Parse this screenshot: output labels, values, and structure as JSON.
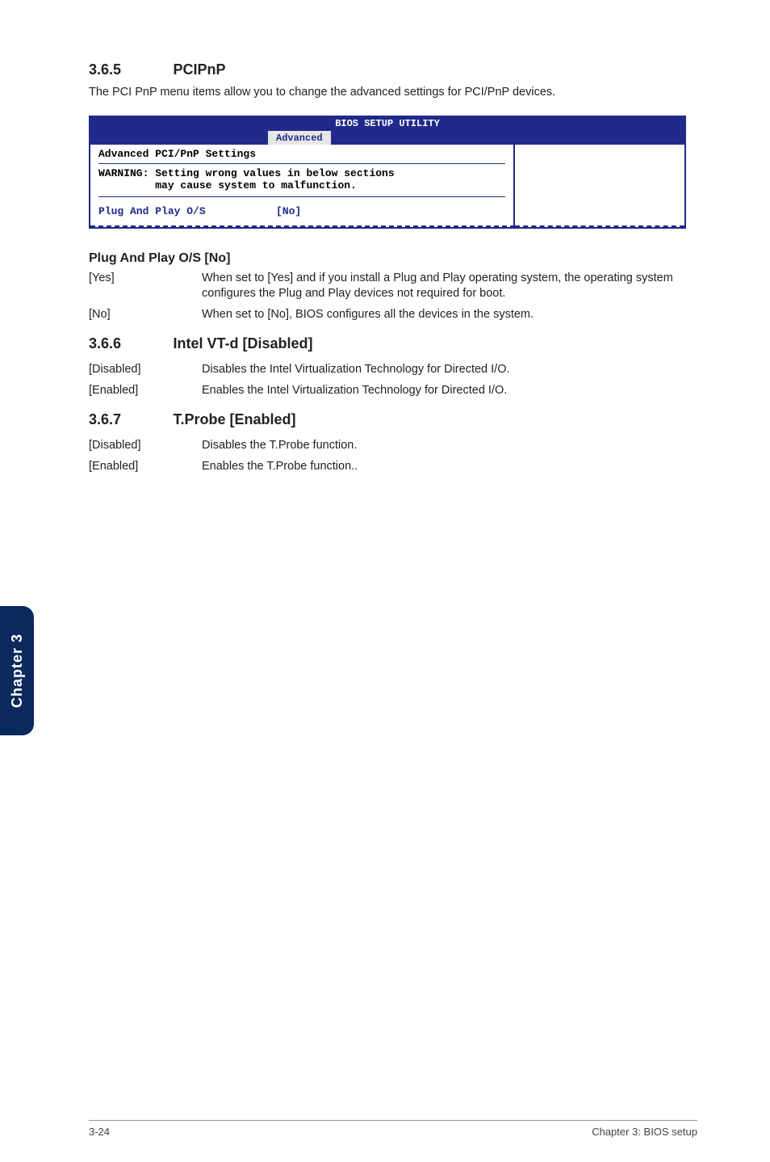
{
  "section365": {
    "num": "3.6.5",
    "title": "PCIPnP",
    "intro": "The PCI PnP menu items allow you to change the advanced settings for PCI/PnP devices."
  },
  "bios": {
    "header": "BIOS SETUP UTILITY",
    "tab": "Advanced",
    "heading": "Advanced PCI/PnP Settings",
    "warning": "WARNING: Setting wrong values in below sections\n         may cause system to malfunction.",
    "item_label": "Plug And Play O/S",
    "item_value": "[No]"
  },
  "plugplay": {
    "heading": "Plug And Play O/S [No]",
    "yes_term": "[Yes]",
    "yes_def": "When set to [Yes] and if you install a Plug and Play operating system, the operating system configures the Plug and Play devices not required for boot.",
    "no_term": "[No]",
    "no_def": "When set to [No], BIOS configures all the devices in the system."
  },
  "section366": {
    "num": "3.6.6",
    "title": "Intel VT-d [Disabled]",
    "disabled_term": "[Disabled]",
    "disabled_def": "Disables the Intel Virtualization Technology for Directed I/O.",
    "enabled_term": "[Enabled]",
    "enabled_def": "Enables the Intel Virtualization Technology for Directed I/O."
  },
  "section367": {
    "num": "3.6.7",
    "title": "T.Probe [Enabled]",
    "disabled_term": "[Disabled]",
    "disabled_def": "Disables the T.Probe function.",
    "enabled_term": "[Enabled]",
    "enabled_def": "Enables the T.Probe function.."
  },
  "sidebar": "Chapter 3",
  "footer_left": "3-24",
  "footer_right": "Chapter 3: BIOS setup"
}
